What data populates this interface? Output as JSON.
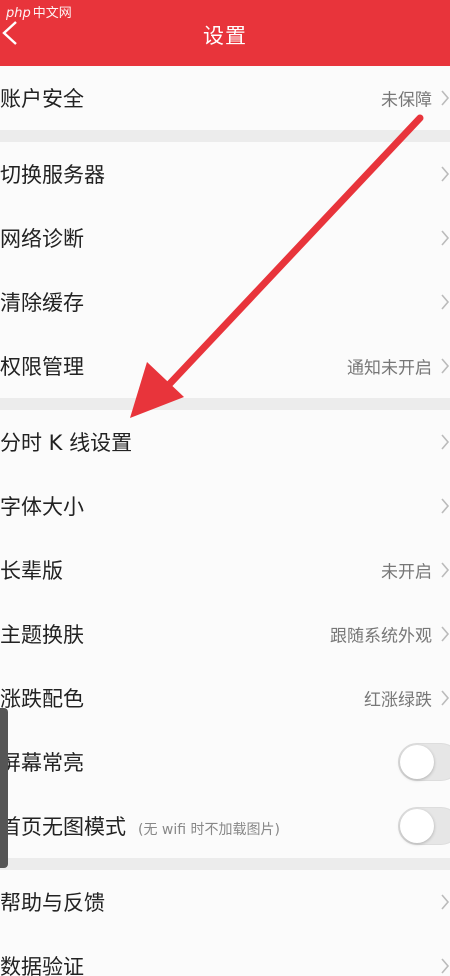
{
  "header": {
    "title": "设置",
    "watermark_php": "php",
    "watermark_cn": "中文网"
  },
  "rows": [
    {
      "label": "账户安全",
      "value": "未保障"
    },
    {
      "label": "切换服务器",
      "value": ""
    },
    {
      "label": "网络诊断",
      "value": ""
    },
    {
      "label": "清除缓存",
      "value": ""
    },
    {
      "label": "权限管理",
      "value": "通知未开启"
    },
    {
      "label": "分时 K 线设置",
      "value": ""
    },
    {
      "label": "字体大小",
      "value": ""
    },
    {
      "label": "长辈版",
      "value": "未开启"
    },
    {
      "label": "主题换肤",
      "value": "跟随系统外观"
    },
    {
      "label": "涨跌配色",
      "value": "红涨绿跌"
    },
    {
      "label": "屏幕常亮",
      "toggle": "off"
    },
    {
      "label": "首页无图模式",
      "hint": "(无 wifi 时不加载图片)",
      "toggle": "off"
    },
    {
      "label": "帮助与反馈",
      "value": ""
    },
    {
      "label": "数据验证",
      "value": ""
    }
  ],
  "colors": {
    "header_bg": "#e8343b",
    "arrow": "#e8343b"
  },
  "icons": {
    "back": "chevron-left-icon",
    "row_chevron": "chevron-right-icon",
    "annotation_arrow": "red-arrow"
  }
}
